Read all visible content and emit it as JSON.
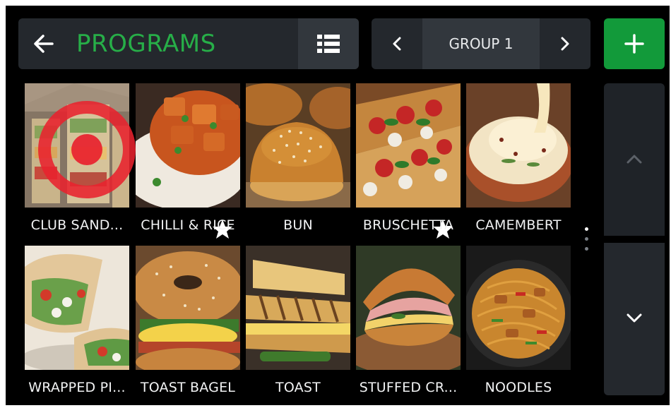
{
  "header": {
    "title": "PROGRAMS",
    "group_label": "GROUP 1"
  },
  "colors": {
    "accent_green": "#27ae48",
    "add_button": "#129a3a",
    "panel": "#24282d",
    "background": "#000000",
    "target_marker": "#e8222e"
  },
  "icons": {
    "back": "arrow-left-icon",
    "list": "list-view-icon",
    "prev_group": "chevron-left-icon",
    "next_group": "chevron-right-icon",
    "add": "plus-icon",
    "scroll_up": "chevron-up-icon",
    "scroll_down": "chevron-down-icon",
    "favorite": "star-icon",
    "target": "target-marker-icon"
  },
  "programs": [
    {
      "label": "CLUB SAND...",
      "favorite": false
    },
    {
      "label": "CHILLI & RICE",
      "favorite": true
    },
    {
      "label": "BUN",
      "favorite": false
    },
    {
      "label": "BRUSCHETTA",
      "favorite": true
    },
    {
      "label": "CAMEMBERT",
      "favorite": false
    },
    {
      "label": "WRAPPED PI...",
      "favorite": false
    },
    {
      "label": "TOAST BAGEL",
      "favorite": false
    },
    {
      "label": "TOAST",
      "favorite": false
    },
    {
      "label": "STUFFED CR...",
      "favorite": false
    },
    {
      "label": "NOODLES",
      "favorite": false
    }
  ],
  "page_indicator": {
    "pages": 3,
    "current": 1
  }
}
